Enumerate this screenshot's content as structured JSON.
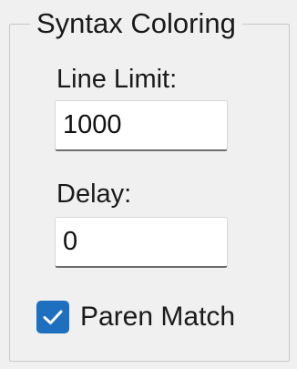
{
  "group": {
    "title": "Syntax Coloring"
  },
  "fields": {
    "line_limit": {
      "label": "Line Limit:",
      "value": "1000"
    },
    "delay": {
      "label": "Delay:",
      "value": "0"
    }
  },
  "paren_match": {
    "label": "Paren Match",
    "checked": true,
    "icon": "checkmark-icon"
  },
  "colors": {
    "accent": "#1f6fc0",
    "background": "#f0f0f0"
  }
}
